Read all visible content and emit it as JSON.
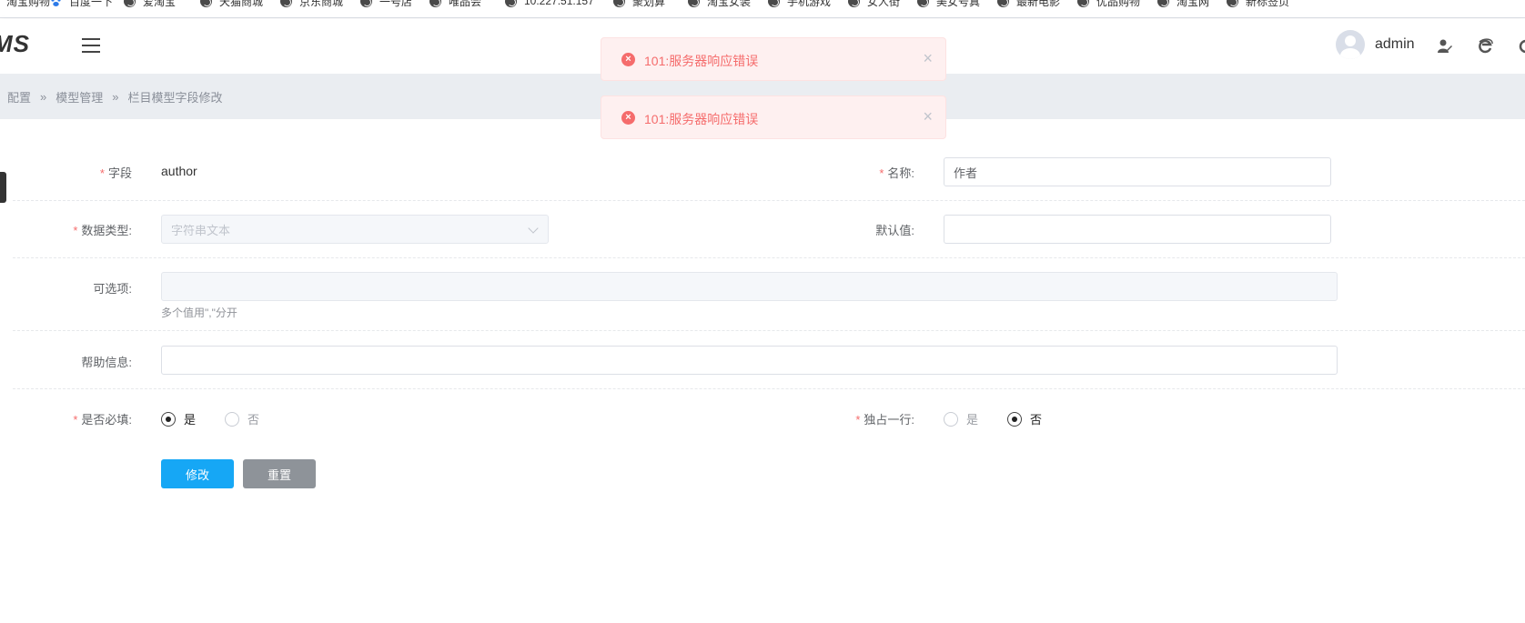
{
  "bookmarks": [
    {
      "label": "淘宝购物",
      "icon": "globe-icon"
    },
    {
      "label": "百度一下",
      "icon": "baidu-paw-icon"
    },
    {
      "label": "爱淘宝",
      "icon": "globe-icon"
    },
    {
      "label": "天猫商城",
      "icon": "globe-icon"
    },
    {
      "label": "京东商城",
      "icon": "globe-icon"
    },
    {
      "label": "一号店",
      "icon": "globe-icon"
    },
    {
      "label": "唯品会",
      "icon": "globe-icon"
    },
    {
      "label": "10.227.51.157",
      "icon": "globe-icon"
    },
    {
      "label": "聚划算",
      "icon": "globe-icon"
    },
    {
      "label": "淘宝女装",
      "icon": "globe-icon"
    },
    {
      "label": "手机游戏",
      "icon": "globe-icon"
    },
    {
      "label": "女人街",
      "icon": "globe-icon"
    },
    {
      "label": "美女号真",
      "icon": "globe-icon"
    },
    {
      "label": "最新电影",
      "icon": "globe-icon"
    },
    {
      "label": "优品购物",
      "icon": "globe-icon"
    },
    {
      "label": "淘宝网",
      "icon": "globe-icon"
    },
    {
      "label": "新标签页",
      "icon": "globe-icon"
    }
  ],
  "header": {
    "logo": "MS",
    "username": "admin"
  },
  "breadcrumb": [
    "配置",
    "模型管理",
    "栏目模型字段修改"
  ],
  "breadcrumb_sep": "»",
  "toasts": [
    {
      "message": "101:服务器响应错误"
    },
    {
      "message": "101:服务器响应错误"
    }
  ],
  "toast_close": "×",
  "form": {
    "field": {
      "label": "字段",
      "value": "author",
      "required": "*"
    },
    "name": {
      "label": "名称:",
      "value": "作者",
      "required": "*"
    },
    "datatype": {
      "label": "数据类型:",
      "value": "字符串文本",
      "required": "*"
    },
    "default": {
      "label": "默认值:",
      "value": ""
    },
    "options": {
      "label": "可选项:",
      "value": "",
      "hint": "多个值用\",\"分开"
    },
    "help": {
      "label": "帮助信息:",
      "value": ""
    },
    "required_flag": {
      "label": "是否必填:",
      "required": "*",
      "options": [
        "是",
        "否"
      ],
      "selected": "是"
    },
    "single_row": {
      "label": "独占一行:",
      "required": "*",
      "options": [
        "是",
        "否"
      ],
      "selected": "否"
    }
  },
  "buttons": {
    "submit": "修改",
    "reset": "重置"
  },
  "colors": {
    "primary": "#16a7f5",
    "secondary": "#8e9399",
    "error": "#f56c6c",
    "error_bg": "#fef0f0"
  }
}
